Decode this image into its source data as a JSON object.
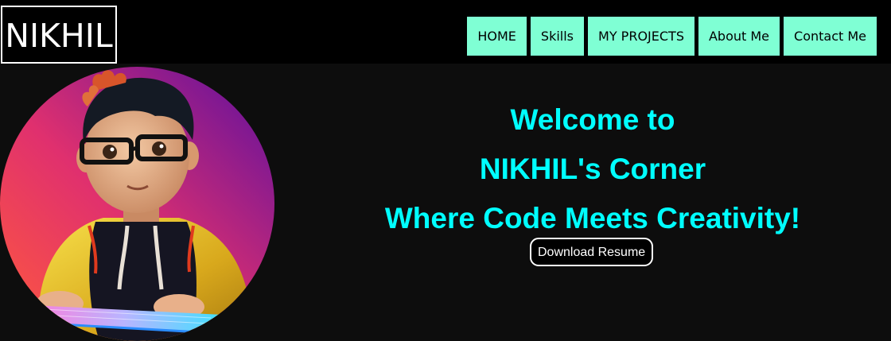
{
  "navbar": {
    "logo": "NIKHIL",
    "links": [
      {
        "label": "HOME"
      },
      {
        "label": "Skills"
      },
      {
        "label": "MY PROJECTS"
      },
      {
        "label": "About Me"
      },
      {
        "label": "Contact Me"
      }
    ],
    "link_bg_color": "#7fffd4"
  },
  "hero": {
    "heading_lines": [
      "Welcome to",
      "NIKHIL's Corner",
      "Where Code Meets Creativity!"
    ],
    "heading_color": "#00ffff",
    "resume_button": "Download Resume",
    "avatar": "cartoon-developer-avatar"
  }
}
